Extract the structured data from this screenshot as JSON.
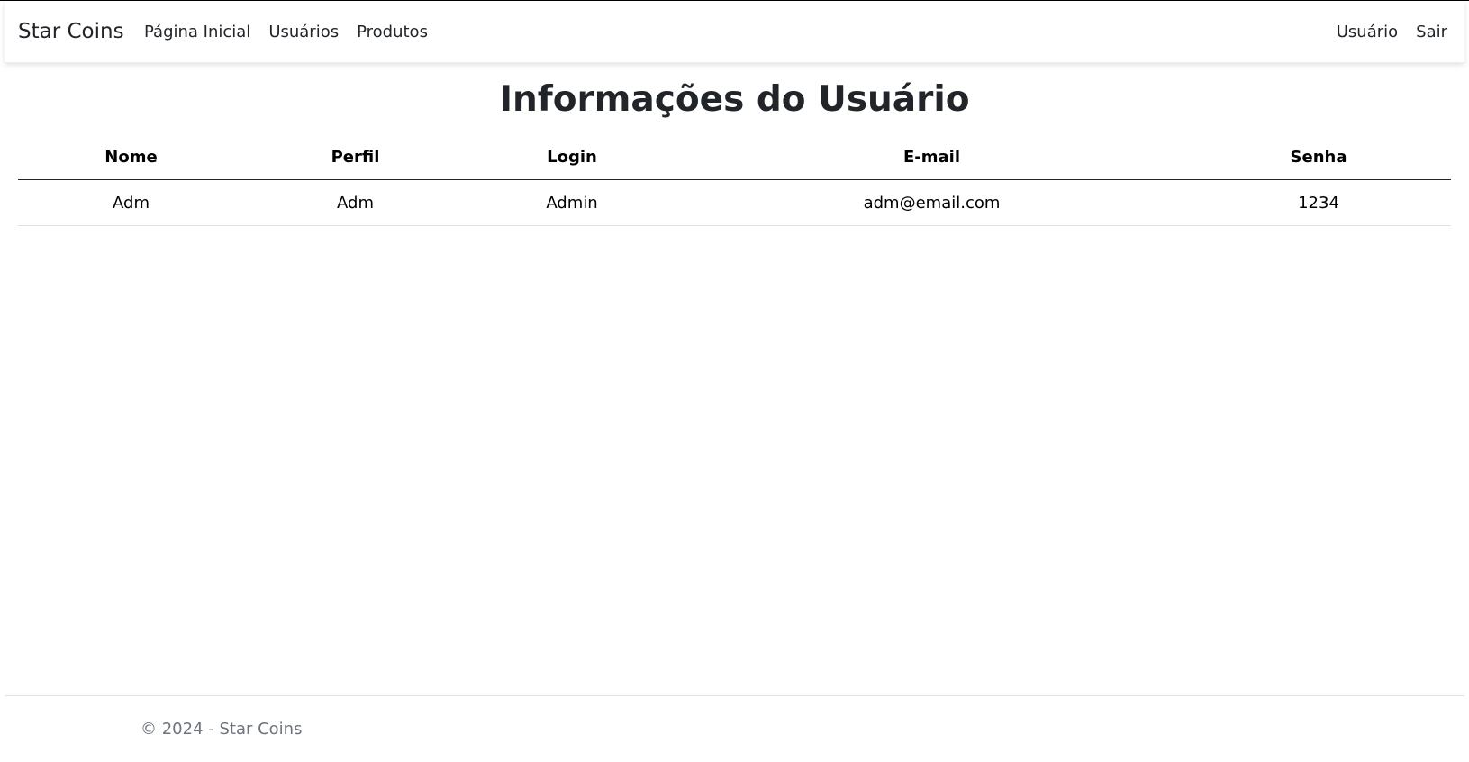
{
  "navbar": {
    "brand": "Star Coins",
    "left_links": [
      "Página Inicial",
      "Usuários",
      "Produtos"
    ],
    "right_links": [
      "Usuário",
      "Sair"
    ]
  },
  "page": {
    "title": "Informações do Usuário"
  },
  "table": {
    "headers": [
      "Nome",
      "Perfil",
      "Login",
      "E-mail",
      "Senha"
    ],
    "rows": [
      [
        "Adm",
        "Adm",
        "Admin",
        "adm@email.com",
        "1234"
      ]
    ]
  },
  "footer": {
    "text": "© 2024 - Star Coins"
  }
}
